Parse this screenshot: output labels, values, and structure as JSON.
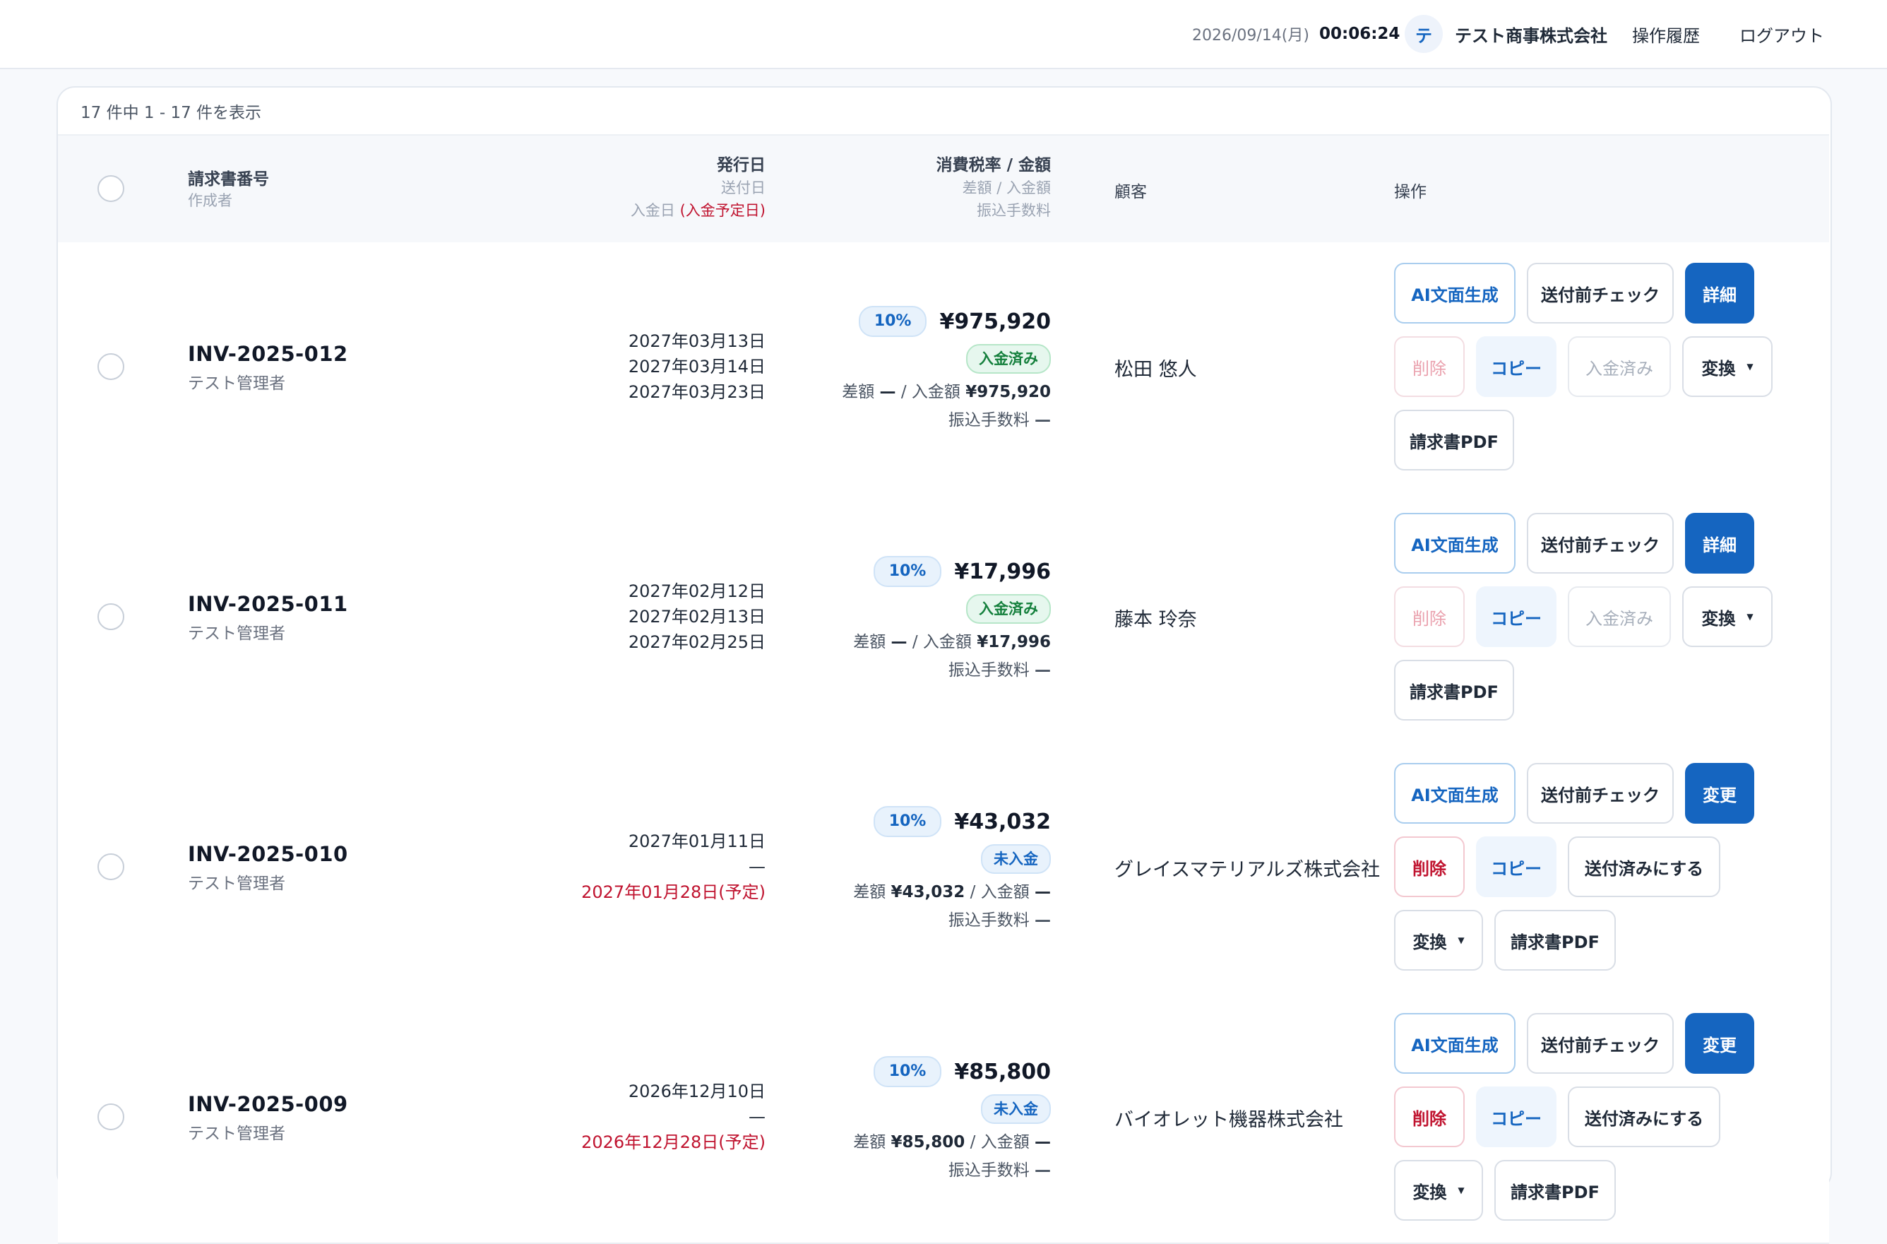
{
  "topbar": {
    "date": "2026/09/14(月)",
    "time": "00:06:24",
    "avatar_initial": "テ",
    "company": "テスト商事株式会社",
    "history_label": "操作履歴",
    "logout_label": "ログアウト"
  },
  "summary": {
    "count_text": "17 件中 1 - 17 件を表示"
  },
  "columns": {
    "invoice_no": "請求書番号",
    "creator": "作成者",
    "issue_date": "発行日",
    "send_date": "送付日",
    "payment_date": "入金日",
    "payment_planned": "(入金予定日)",
    "tax_amount": "消費税率 / 金額",
    "diff_paid": "差額 / 入金額",
    "fee": "振込手数料",
    "customer": "顧客",
    "actions": "操作"
  },
  "rows": [
    {
      "invoice_no": "INV-2025-012",
      "creator": "テスト管理者",
      "issue_date": "2027年03月13日",
      "send_date": "2027年03月14日",
      "payment_date": "2027年03月23日",
      "tax_rate": "10%",
      "total": "¥975,920",
      "status": "入金済み",
      "diff_label": "差額",
      "diff_value": "—",
      "paid_label": "入金額",
      "paid_value": "¥975,920",
      "fee_label": "振込手数料",
      "fee_value": "—",
      "customer": "松田 悠人",
      "actions": {
        "ai": "AI文面生成",
        "precheck": "送付前チェック",
        "main": "詳細",
        "delete": "削除",
        "copy": "コピー",
        "status_action": "入金済み",
        "convert": "変換",
        "pdf": "請求書PDF"
      }
    },
    {
      "invoice_no": "INV-2025-011",
      "creator": "テスト管理者",
      "issue_date": "2027年02月12日",
      "send_date": "2027年02月13日",
      "payment_date": "2027年02月25日",
      "tax_rate": "10%",
      "total": "¥17,996",
      "status": "入金済み",
      "diff_label": "差額",
      "diff_value": "—",
      "paid_label": "入金額",
      "paid_value": "¥17,996",
      "fee_label": "振込手数料",
      "fee_value": "—",
      "customer": "藤本 玲奈",
      "actions": {
        "ai": "AI文面生成",
        "precheck": "送付前チェック",
        "main": "詳細",
        "delete": "削除",
        "copy": "コピー",
        "status_action": "入金済み",
        "convert": "変換",
        "pdf": "請求書PDF"
      }
    },
    {
      "invoice_no": "INV-2025-010",
      "creator": "テスト管理者",
      "issue_date": "2027年01月11日",
      "send_date": "—",
      "payment_date": "2027年01月28日(予定)",
      "tax_rate": "10%",
      "total": "¥43,032",
      "status": "未入金",
      "diff_label": "差額",
      "diff_value": "¥43,032",
      "paid_label": "入金額",
      "paid_value": "—",
      "fee_label": "振込手数料",
      "fee_value": "—",
      "customer": "グレイスマテリアルズ株式会社",
      "actions": {
        "ai": "AI文面生成",
        "precheck": "送付前チェック",
        "main": "変更",
        "delete": "削除",
        "copy": "コピー",
        "status_action": "送付済みにする",
        "convert": "変換",
        "pdf": "請求書PDF"
      }
    },
    {
      "invoice_no": "INV-2025-009",
      "creator": "テスト管理者",
      "issue_date": "2026年12月10日",
      "send_date": "—",
      "payment_date": "2026年12月28日(予定)",
      "tax_rate": "10%",
      "total": "¥85,800",
      "status": "未入金",
      "diff_label": "差額",
      "diff_value": "¥85,800",
      "paid_label": "入金額",
      "paid_value": "—",
      "fee_label": "振込手数料",
      "fee_value": "—",
      "customer": "バイオレット機器株式会社",
      "actions": {
        "ai": "AI文面生成",
        "precheck": "送付前チェック",
        "main": "変更",
        "delete": "削除",
        "copy": "コピー",
        "status_action": "送付済みにする",
        "convert": "変換",
        "pdf": "請求書PDF"
      }
    }
  ]
}
